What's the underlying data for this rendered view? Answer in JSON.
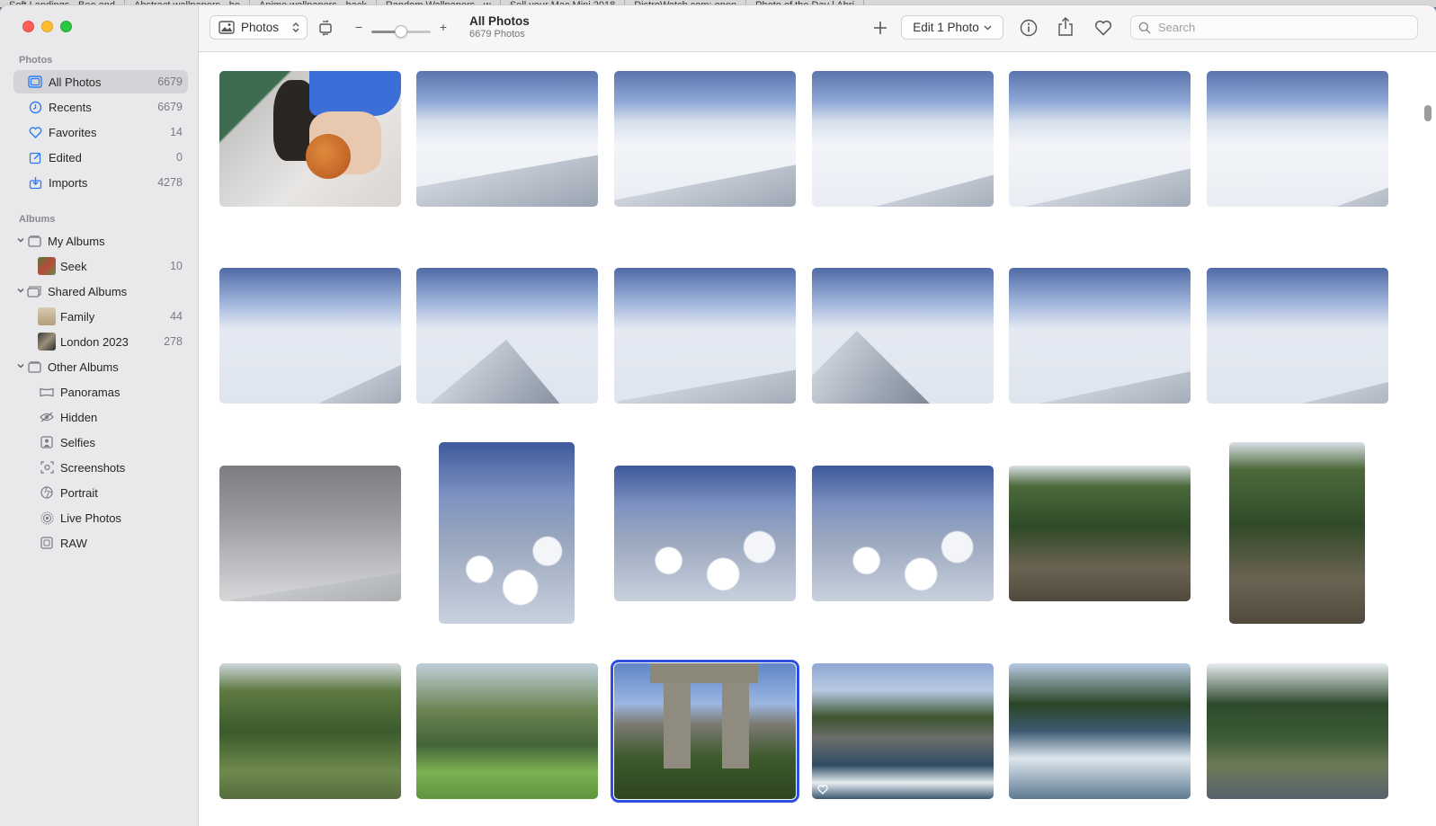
{
  "background_tabs": [
    "Soft Landings - Bee and",
    "Abstract wallpapers - be",
    "Anime wallpapers - back",
    "Random Wallpapers - w",
    "Sell your Mac Mini 2018",
    "DistroWatch.com: open",
    "Photo of the Day | Abri"
  ],
  "sidebar": {
    "photos_section": "Photos",
    "albums_section": "Albums",
    "library": [
      {
        "label": "All Photos",
        "count": "6679",
        "icon": "photos-grid-icon"
      },
      {
        "label": "Recents",
        "count": "6679",
        "icon": "clock-icon"
      },
      {
        "label": "Favorites",
        "count": "14",
        "icon": "heart-icon"
      },
      {
        "label": "Edited",
        "count": "0",
        "icon": "edit-icon"
      },
      {
        "label": "Imports",
        "count": "4278",
        "icon": "import-icon"
      }
    ],
    "my_albums": {
      "label": "My Albums",
      "items": [
        {
          "label": "Seek",
          "count": "10"
        }
      ]
    },
    "shared_albums": {
      "label": "Shared Albums",
      "items": [
        {
          "label": "Family",
          "count": "44"
        },
        {
          "label": "London 2023",
          "count": "278"
        }
      ]
    },
    "other_albums": {
      "label": "Other Albums",
      "items": [
        {
          "label": "Panoramas"
        },
        {
          "label": "Hidden"
        },
        {
          "label": "Selfies"
        },
        {
          "label": "Screenshots"
        },
        {
          "label": "Portrait"
        },
        {
          "label": "Live Photos"
        },
        {
          "label": "RAW"
        }
      ]
    }
  },
  "toolbar": {
    "view_selector": "Photos",
    "zoom_minus": "−",
    "zoom_plus": "+",
    "title": "All Photos",
    "subtitle": "6679 Photos",
    "edit_button": "Edit 1 Photo",
    "search_placeholder": "Search"
  },
  "colors": {
    "accent": "#2c7cf6",
    "selection": "#2c4fe0"
  }
}
